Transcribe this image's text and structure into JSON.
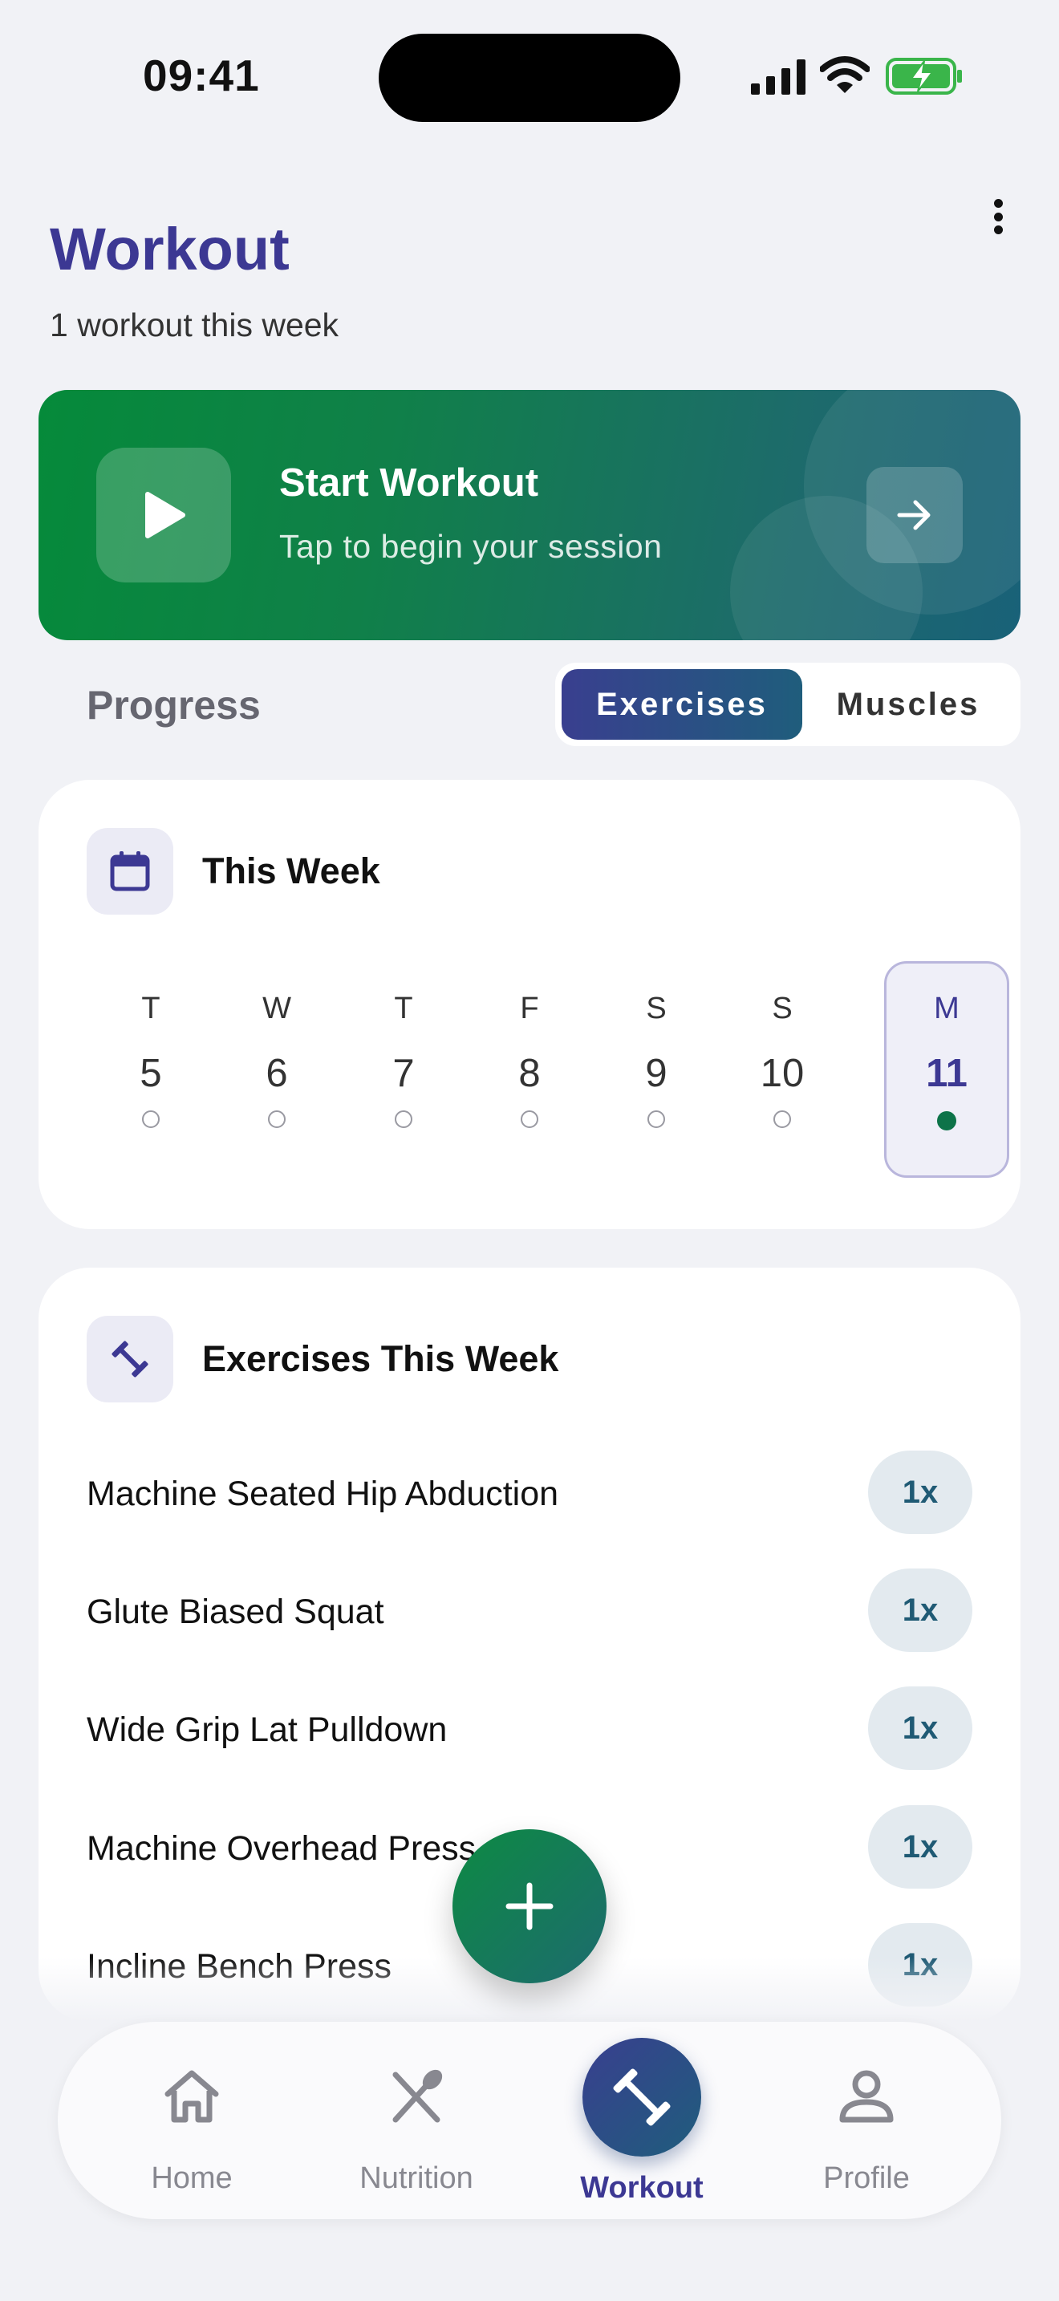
{
  "status_bar": {
    "time": "09:41"
  },
  "header": {
    "title": "Workout",
    "subtitle": "1 workout this week"
  },
  "start_card": {
    "title": "Start Workout",
    "subtitle": "Tap to begin your session"
  },
  "progress": {
    "label": "Progress",
    "toggle": {
      "options": [
        "Exercises",
        "Muscles"
      ],
      "selected": "Exercises"
    }
  },
  "week_card": {
    "title": "This Week",
    "days": [
      {
        "letter": "T",
        "number": "5"
      },
      {
        "letter": "W",
        "number": "6"
      },
      {
        "letter": "T",
        "number": "7"
      },
      {
        "letter": "F",
        "number": "8"
      },
      {
        "letter": "S",
        "number": "9"
      },
      {
        "letter": "S",
        "number": "10"
      },
      {
        "letter": "M",
        "number": "11",
        "today": true,
        "has_workout": true
      }
    ]
  },
  "exercises_card": {
    "title": "Exercises This Week",
    "items": [
      {
        "name": "Machine Seated Hip Abduction",
        "count": "1x"
      },
      {
        "name": "Glute Biased Squat",
        "count": "1x"
      },
      {
        "name": "Wide Grip Lat Pulldown",
        "count": "1x"
      },
      {
        "name": "Machine Overhead Press",
        "count": "1x"
      },
      {
        "name": "Incline Bench Press",
        "count": "1x"
      }
    ]
  },
  "bottom_nav": {
    "items": [
      {
        "label": "Home",
        "icon": "home-icon"
      },
      {
        "label": "Nutrition",
        "icon": "utensils-icon"
      },
      {
        "label": "Workout",
        "icon": "dumbbell-icon",
        "active": true
      },
      {
        "label": "Profile",
        "icon": "person-icon"
      }
    ]
  },
  "colors": {
    "accent": "#3c3893",
    "green": "#058a3a",
    "teal": "#1f5d7c",
    "background": "#f1f2f6"
  }
}
